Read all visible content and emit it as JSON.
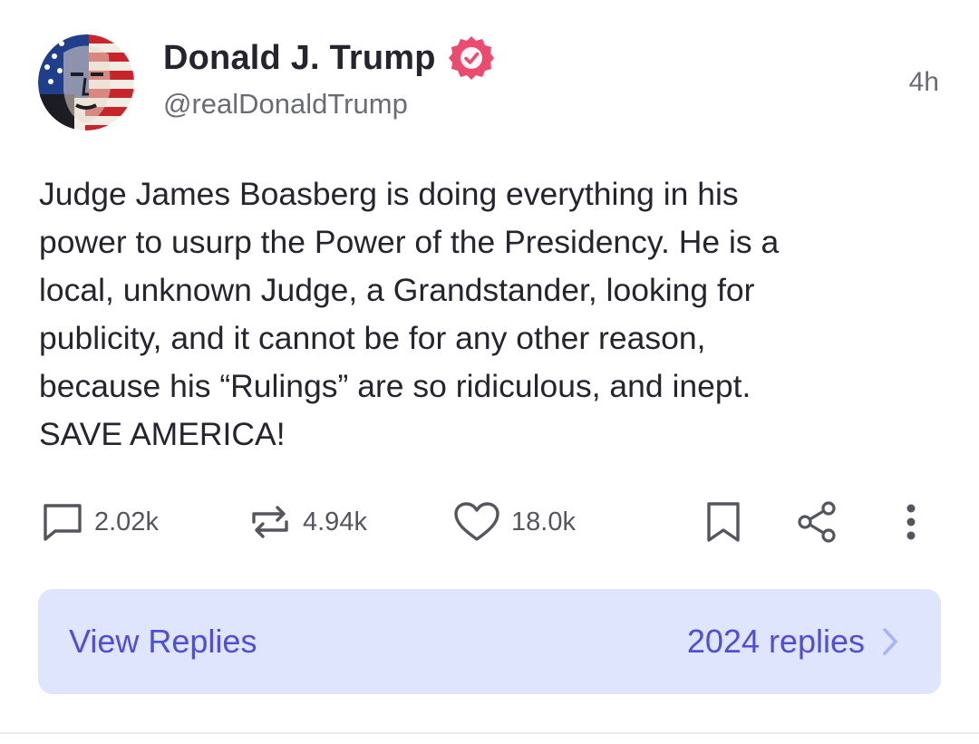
{
  "post": {
    "author": {
      "display_name": "Donald J. Trump",
      "handle": "@realDonaldTrump",
      "verified": true,
      "verified_color": "#ec4a6e",
      "avatar_icon": "flag-face-avatar"
    },
    "timestamp": "4h",
    "body": "Judge James Boasberg is doing everything in his\npower to usurp the Power of the Presidency. He is a\nlocal, unknown Judge, a Grandstander, looking for\npublicity, and it cannot be for any other reason,\nbecause his “Rulings” are so ridiculous, and inept.\nSAVE AMERICA!",
    "actions": {
      "replies": {
        "icon": "comment-icon",
        "count": "2.02k"
      },
      "retruths": {
        "icon": "repost-icon",
        "count": "4.94k"
      },
      "likes": {
        "icon": "heart-icon",
        "count": "18.0k"
      },
      "bookmark": {
        "icon": "bookmark-icon"
      },
      "share": {
        "icon": "share-icon"
      },
      "more": {
        "icon": "more-vertical-icon"
      }
    },
    "replies_bar": {
      "label": "View Replies",
      "count_label": "2024 replies",
      "icon": "chevron-right-icon",
      "background": "#dfe5fd",
      "accent": "#4f4ed8"
    }
  }
}
